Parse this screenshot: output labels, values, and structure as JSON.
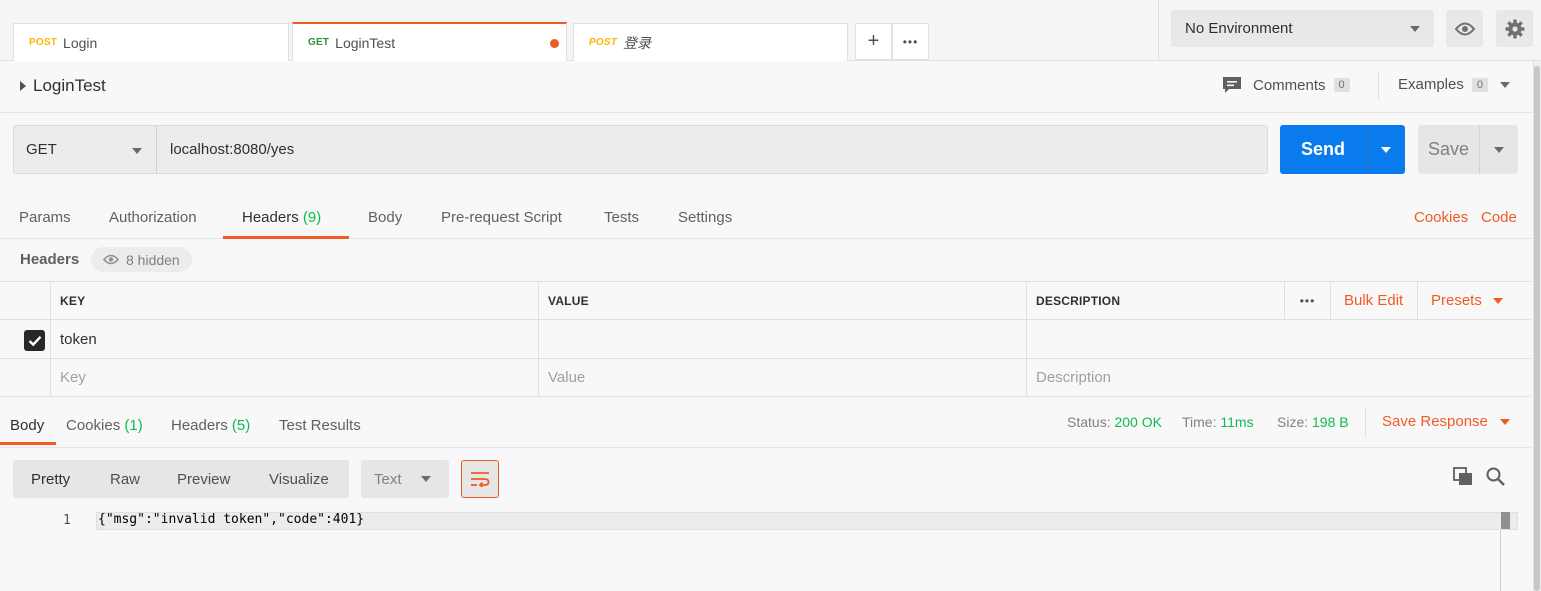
{
  "tabs": [
    {
      "method": "POST",
      "name": "Login"
    },
    {
      "method": "GET",
      "name": "LoginTest",
      "unsaved": true
    },
    {
      "method": "POST",
      "name": "登录"
    }
  ],
  "tab_actions": {
    "new": "+",
    "more": "•••"
  },
  "environment": {
    "selected": "No Environment"
  },
  "request": {
    "name": "LoginTest",
    "comments_label": "Comments",
    "comments_count": "0",
    "examples_label": "Examples",
    "examples_count": "0",
    "method": "GET",
    "url": "localhost:8080/yes",
    "send_label": "Send",
    "save_label": "Save"
  },
  "request_tabs": {
    "params": "Params",
    "authorization": "Authorization",
    "headers": "Headers",
    "headers_count": "(9)",
    "body": "Body",
    "prerequest": "Pre-request Script",
    "tests": "Tests",
    "settings": "Settings",
    "cookies_link": "Cookies",
    "code_link": "Code"
  },
  "headers_section": {
    "title": "Headers",
    "hidden_label": "8 hidden",
    "columns": {
      "key": "KEY",
      "value": "VALUE",
      "description": "DESCRIPTION"
    },
    "bulk_edit": "Bulk Edit",
    "presets": "Presets",
    "rows": [
      {
        "key": "token",
        "value": "",
        "description": "",
        "checked": true
      }
    ],
    "placeholders": {
      "key": "Key",
      "value": "Value",
      "description": "Description"
    }
  },
  "response_tabs": {
    "body": "Body",
    "cookies": "Cookies",
    "cookies_count": "(1)",
    "headers": "Headers",
    "headers_count": "(5)",
    "test_results": "Test Results"
  },
  "response_status": {
    "status_label": "Status:",
    "status_value": "200 OK",
    "time_label": "Time:",
    "time_value": "11ms",
    "size_label": "Size:",
    "size_value": "198 B",
    "save_response": "Save Response"
  },
  "body_view": {
    "pretty": "Pretty",
    "raw": "Raw",
    "preview": "Preview",
    "visualize": "Visualize",
    "format": "Text"
  },
  "editor": {
    "line_number": "1",
    "content": "{\"msg\":\"invalid token\",\"code\":401}"
  },
  "colors": {
    "accent": "#ef5b25",
    "send": "#097bed",
    "success": "#0cbb52",
    "post": "#ffb400",
    "get": "#0cbb52"
  }
}
